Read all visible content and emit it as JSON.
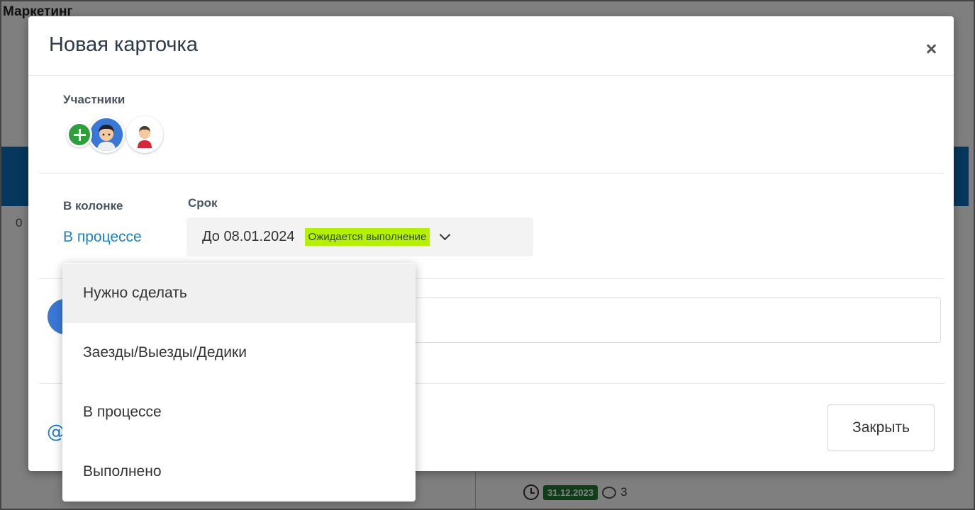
{
  "background": {
    "board_title": "Маркетинг",
    "count_fragment": "0",
    "card": {
      "date": "31.12.2023",
      "comments": "3",
      "date_color": "#1e7a34"
    }
  },
  "modal": {
    "title": "Новая карточка",
    "close_icon": "close-icon",
    "participants": {
      "label": "Участники",
      "add_icon": "plus-icon",
      "avatars": [
        "avatar-boy",
        "avatar-man-red-shirt"
      ]
    },
    "column": {
      "label": "В колонке",
      "value": "В процессе"
    },
    "deadline": {
      "label": "Срок",
      "value": "До 08.01.2024",
      "status": "Ожидается выполнение",
      "status_color": "#b4f000"
    },
    "comment": {
      "placeholder": ""
    },
    "footer": {
      "attach_icon": "at-icon",
      "close_label": "Закрыть"
    }
  },
  "dropdown": {
    "items": [
      {
        "label": "Нужно сделать",
        "highlighted": true
      },
      {
        "label": "Заезды/Выезды/Дедики",
        "highlighted": false
      },
      {
        "label": "В процессе",
        "highlighted": false
      },
      {
        "label": "Выполнено",
        "highlighted": false
      }
    ]
  },
  "colors": {
    "accent": "#1f7fc8",
    "add_button": "#2f9e3c",
    "header_blue": "#0d6fb8"
  }
}
